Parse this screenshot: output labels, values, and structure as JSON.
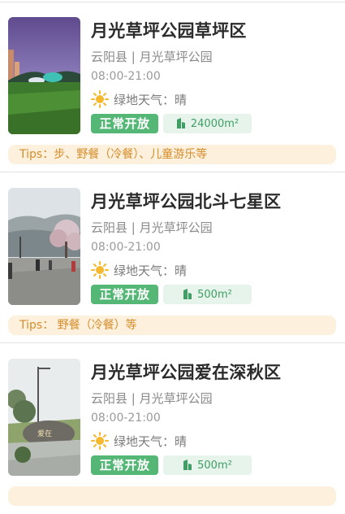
{
  "unit_symbol": "m²",
  "cards": [
    {
      "title": "月光草坪公园草坪区",
      "location": "云阳县 | 月光草坪公园",
      "hours": "08:00-21:00",
      "weather": "绿地天气：晴",
      "status": "正常开放",
      "area": "24000",
      "tips": "Tips：步、野餐（冷餐）、儿童游乐等"
    },
    {
      "title": "月光草坪公园北斗七星区",
      "location": "云阳县 | 月光草坪公园",
      "hours": "08:00-21:00",
      "weather": "绿地天气：晴",
      "status": "正常开放",
      "area": "500",
      "tips": "Tips： 野餐（冷餐）等"
    },
    {
      "title": "月光草坪公园爱在深秋区",
      "location": "云阳县 | 月光草坪公园",
      "hours": "08:00-21:00",
      "weather": "绿地天气：晴",
      "status": "正常开放",
      "area": "500",
      "tips": ""
    }
  ],
  "colors": {
    "status_green": "#55b776",
    "area_bg": "#e6f4ec",
    "tips_bg": "#fdf0dc",
    "tips_text": "#d58d2b"
  },
  "icons": {
    "weather": "sun-icon",
    "area": "building-icon"
  }
}
